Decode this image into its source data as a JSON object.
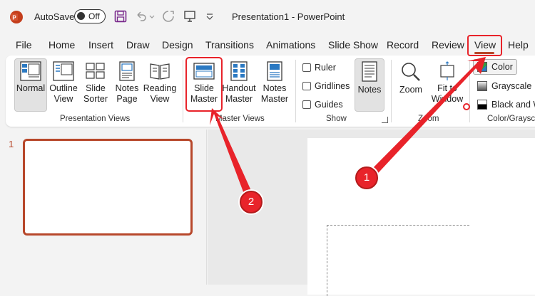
{
  "titlebar": {
    "autosave_label": "AutoSave",
    "autosave_state": "Off",
    "document_title": "Presentation1  -  PowerPoint"
  },
  "tabs": [
    "File",
    "Home",
    "Insert",
    "Draw",
    "Design",
    "Transitions",
    "Animations",
    "Slide Show",
    "Record",
    "Review",
    "View",
    "Help"
  ],
  "ribbon": {
    "presentation_views": {
      "label": "Presentation Views",
      "buttons": [
        {
          "line1": "Normal",
          "line2": ""
        },
        {
          "line1": "Outline",
          "line2": "View"
        },
        {
          "line1": "Slide",
          "line2": "Sorter"
        },
        {
          "line1": "Notes",
          "line2": "Page"
        },
        {
          "line1": "Reading",
          "line2": "View"
        }
      ]
    },
    "master_views": {
      "label": "Master Views",
      "buttons": [
        {
          "line1": "Slide",
          "line2": "Master"
        },
        {
          "line1": "Handout",
          "line2": "Master"
        },
        {
          "line1": "Notes",
          "line2": "Master"
        }
      ]
    },
    "show": {
      "label": "Show",
      "checkboxes": [
        "Ruler",
        "Gridlines",
        "Guides"
      ],
      "notes_label": "Notes"
    },
    "zoom": {
      "label": "Zoom",
      "zoom_button": "Zoom",
      "fit_line1": "Fit to",
      "fit_line2": "Window"
    },
    "color_grayscale": {
      "label": "Color/Grayscale",
      "items": [
        "Color",
        "Grayscale",
        "Black and White"
      ]
    }
  },
  "slides_pane": {
    "slide_number": "1"
  },
  "annotations": [
    {
      "number": "1",
      "target": "View tab"
    },
    {
      "number": "2",
      "target": "Slide Master button"
    }
  ],
  "colors": {
    "accent": "#b7472a",
    "callout": "#e8232a"
  }
}
